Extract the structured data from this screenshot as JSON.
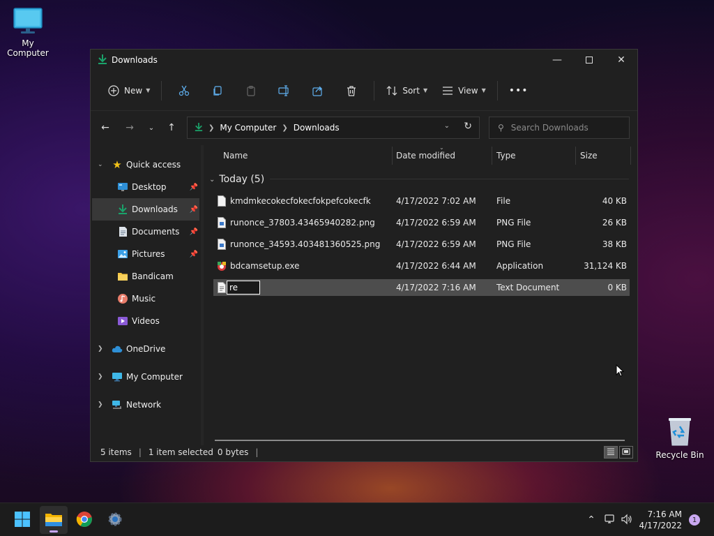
{
  "desktop": {
    "icons": [
      {
        "label": "My Computer"
      },
      {
        "label": "Recycle Bin"
      }
    ]
  },
  "window": {
    "title": "Downloads",
    "ribbon": {
      "new_label": "New",
      "sort_label": "Sort",
      "view_label": "View",
      "more_label": "•••"
    },
    "address": {
      "crumbs": [
        "My Computer",
        "Downloads"
      ],
      "search_placeholder": "Search Downloads"
    },
    "nav": {
      "quick_access": "Quick access",
      "items": [
        {
          "label": "Desktop",
          "pinned": true
        },
        {
          "label": "Downloads",
          "pinned": true
        },
        {
          "label": "Documents",
          "pinned": true
        },
        {
          "label": "Pictures",
          "pinned": true
        },
        {
          "label": "Bandicam",
          "pinned": false
        },
        {
          "label": "Music",
          "pinned": false
        },
        {
          "label": "Videos",
          "pinned": false
        }
      ],
      "roots": [
        "OneDrive",
        "My Computer",
        "Network"
      ]
    },
    "columns": {
      "name": "Name",
      "date": "Date modified",
      "type": "Type",
      "size": "Size"
    },
    "group": {
      "label": "Today (5)"
    },
    "files": [
      {
        "name": "kmdmkecokecfokecfokpefcokecfk",
        "date": "4/17/2022 7:02 AM",
        "type": "File",
        "size": "40 KB"
      },
      {
        "name": "runonce_37803.43465940282.png",
        "date": "4/17/2022 6:59 AM",
        "type": "PNG File",
        "size": "26 KB"
      },
      {
        "name": "runonce_34593.403481360525.png",
        "date": "4/17/2022 6:59 AM",
        "type": "PNG File",
        "size": "38 KB"
      },
      {
        "name": "bdcamsetup.exe",
        "date": "4/17/2022 6:44 AM",
        "type": "Application",
        "size": "31,124 KB"
      },
      {
        "name": "re",
        "date": "4/17/2022 7:16 AM",
        "type": "Text Document",
        "size": "0 KB",
        "renaming": true
      }
    ],
    "status": {
      "items": "5 items",
      "selected": "1 item selected",
      "bytes": "0 bytes"
    }
  },
  "taskbar": {
    "time": "7:16 AM",
    "date": "4/17/2022",
    "notifications": "1"
  },
  "colors": {
    "accent_green": "#1aa36a",
    "selection": "#4d4d4d",
    "window_bg": "#202020",
    "taskbar_bg": "#1c1c1c"
  }
}
